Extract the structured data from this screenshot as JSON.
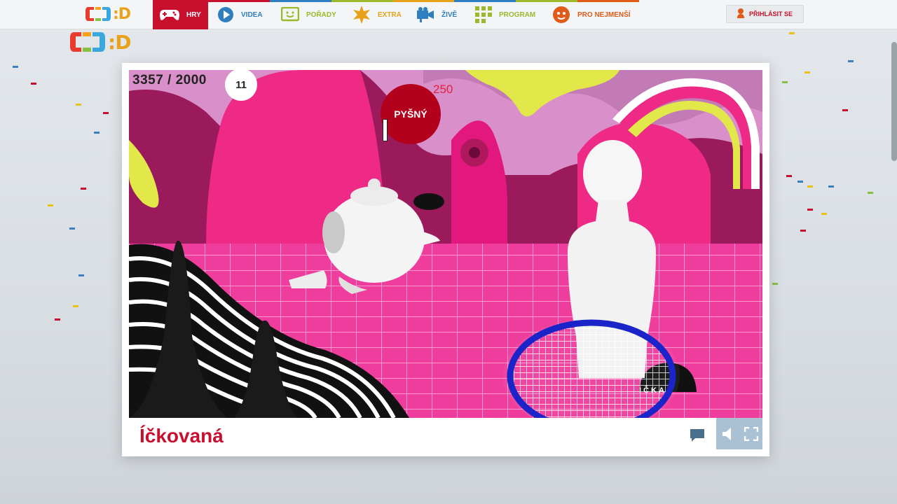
{
  "brand": {
    "logo_text": ":D",
    "logo_colors": [
      "#e83a2f",
      "#f6a21a",
      "#3aa8dc",
      "#88c046"
    ]
  },
  "nav": {
    "items": [
      {
        "label": "HRY",
        "icon": "gamepad-icon",
        "color": "#ffffff",
        "active": true
      },
      {
        "label": "VIDEA",
        "icon": "play-icon",
        "color": "#2f7fc0"
      },
      {
        "label": "POŘADY",
        "icon": "tv-face-icon",
        "color": "#9cb82c"
      },
      {
        "label": "EXTRA",
        "icon": "star-burst-icon",
        "color": "#e8a21a"
      },
      {
        "label": "ŽIVĚ",
        "icon": "camera-icon",
        "color": "#2f7fc0"
      },
      {
        "label": "PROGRAM",
        "icon": "grid-icon",
        "color": "#9cb82c"
      },
      {
        "label": "PRO NEJMENŠÍ",
        "icon": "face-icon",
        "color": "#e05a1a"
      }
    ],
    "login_label": "PŘIHLÁSIT SE",
    "accent": "#c8102e"
  },
  "game": {
    "score": "3357 / 2000",
    "lives": "11",
    "word": "PYŠNÝ",
    "points": "250",
    "hole_label": "IČKA",
    "title": "Íčkovaná"
  }
}
